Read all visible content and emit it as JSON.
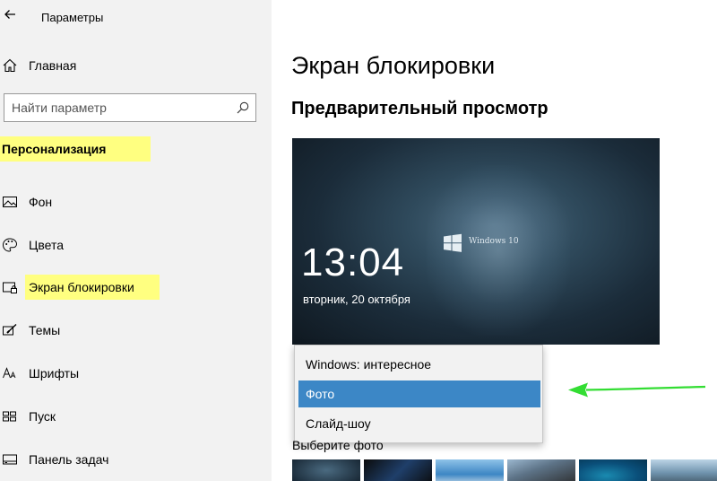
{
  "app": {
    "title": "Параметры"
  },
  "sidebar": {
    "home_label": "Главная",
    "search_placeholder": "Найти параметр",
    "section_header": "Персонализация",
    "items": [
      {
        "label": "Фон",
        "icon": "picture-icon"
      },
      {
        "label": "Цвета",
        "icon": "palette-icon"
      },
      {
        "label": "Экран блокировки",
        "icon": "lock-screen-icon",
        "active": true
      },
      {
        "label": "Темы",
        "icon": "brush-icon"
      },
      {
        "label": "Шрифты",
        "icon": "font-icon"
      },
      {
        "label": "Пуск",
        "icon": "start-icon"
      },
      {
        "label": "Панель задач",
        "icon": "taskbar-icon"
      }
    ]
  },
  "main": {
    "page_title": "Экран блокировки",
    "preview_title": "Предварительный просмотр",
    "preview": {
      "logo_text": "Windows 10",
      "time": "13:04",
      "date": "вторник, 20 октября"
    },
    "dropdown": {
      "options": [
        "Windows: интересное",
        "Фото",
        "Слайд-шоу"
      ],
      "selected": "Фото"
    },
    "choose_photo_label": "Выберите фото"
  },
  "colors": {
    "highlight": "#ffff80",
    "selected_option": "#3c87c6",
    "arrow": "#33dd33",
    "sidebar_bg": "#f2f2f2"
  }
}
